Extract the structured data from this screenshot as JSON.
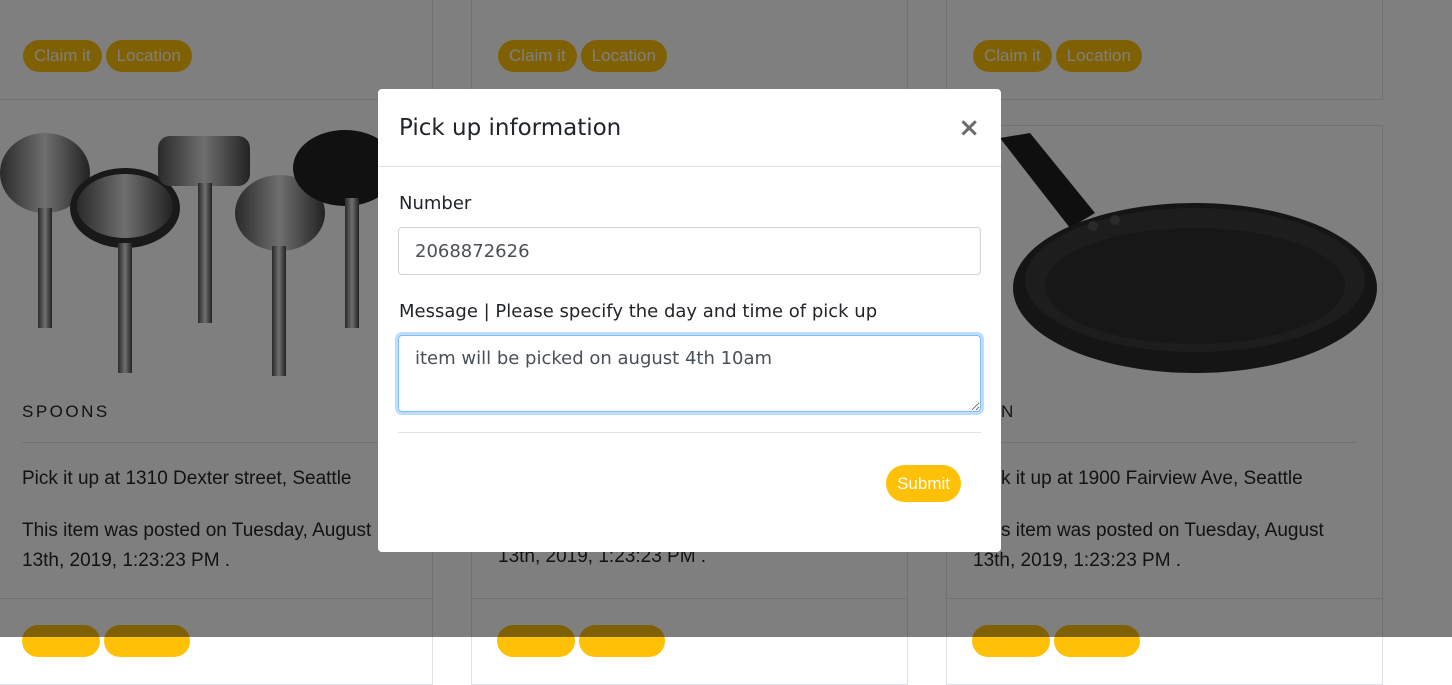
{
  "cards": [
    {
      "claim_label": "Claim it",
      "location_label": "Location",
      "title": "SPOONS",
      "pickup": "Pick it up at 1310 Dexter street, Seattle",
      "posted": "This item was posted on Tuesday, August 13th, 2019, 1:23:23 PM ."
    },
    {
      "claim_label": "Claim it",
      "location_label": "Location",
      "title": "",
      "pickup": "",
      "posted": "13th, 2019, 1:23:23 PM ."
    },
    {
      "claim_label": "Claim it",
      "location_label": "Location",
      "title": "N",
      "pickup": "k it up at 1900 Fairview Ave, Seattle",
      "posted": "s item was posted on Tuesday, August 13th, 2019, 1:23:23 PM ."
    }
  ],
  "modal": {
    "title": "Pick up information",
    "close_symbol": "×",
    "number_label": "Number",
    "number_value": "2068872626",
    "message_label": "Message | Please specify the day and time of pick up",
    "message_value": "item will be picked on august 4th 10am",
    "submit_label": "Submit"
  },
  "colors": {
    "accent": "#ffc107",
    "focus_border": "#80bdff",
    "backdrop": "rgba(0,0,0,0.5)"
  },
  "icons": {
    "close": "close-icon",
    "spoons_image": "kitchen-utensils-image",
    "pan_image": "frying-pan-image"
  }
}
